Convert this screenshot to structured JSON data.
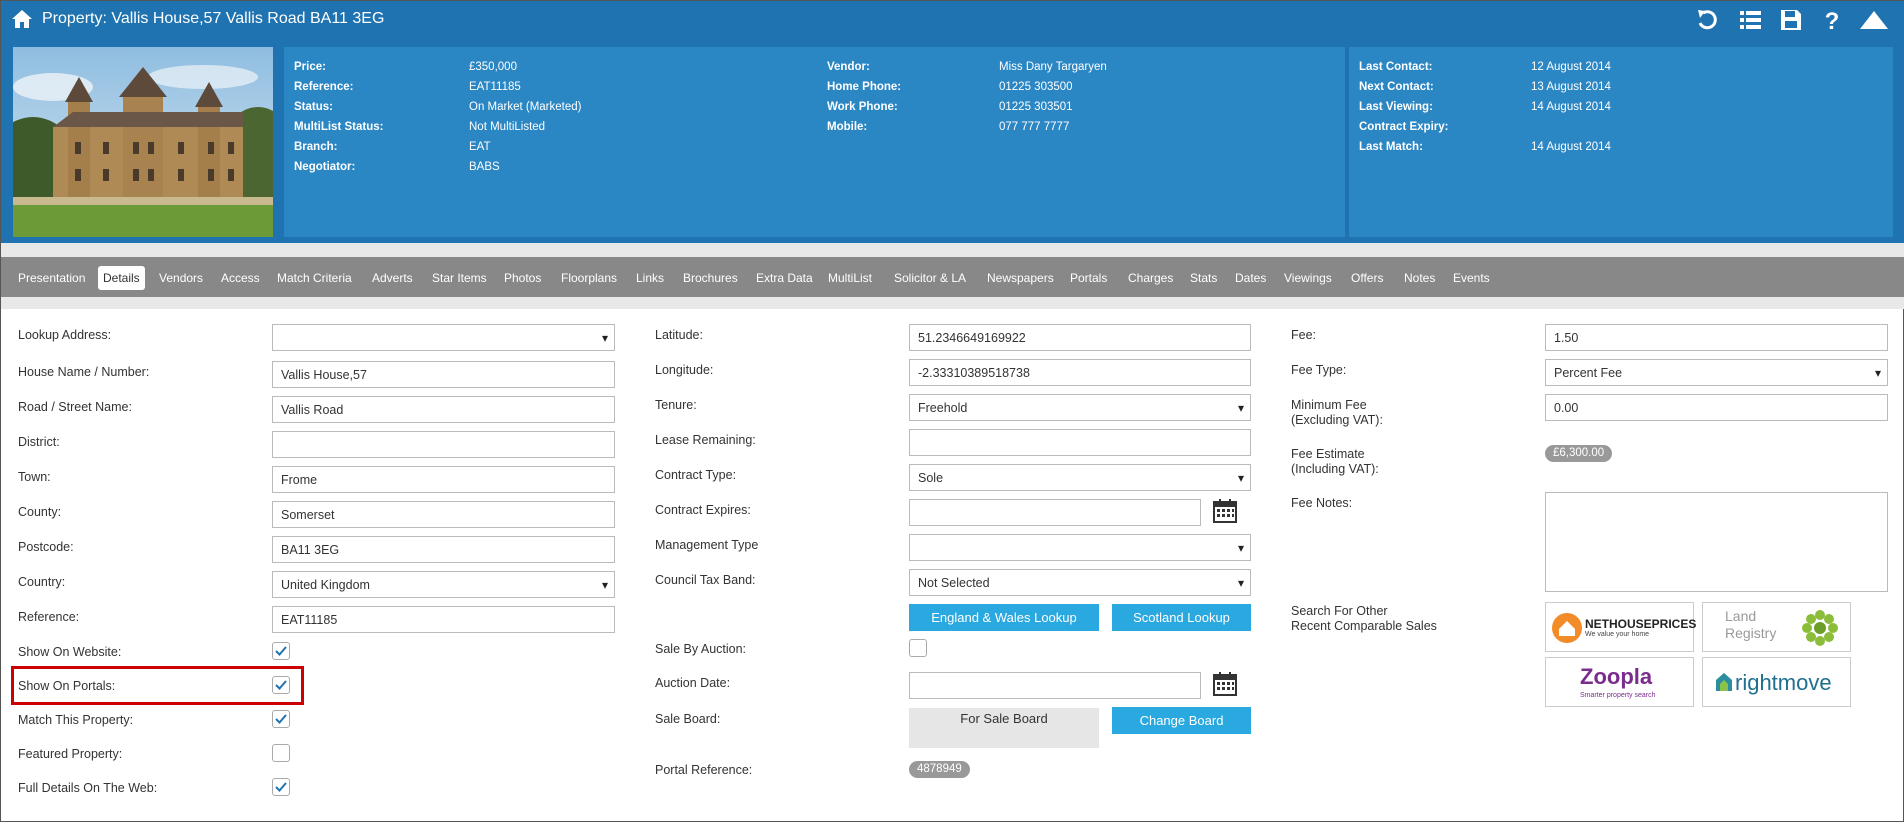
{
  "header": {
    "title": "Property: Vallis House,57 Vallis Road BA11 3EG",
    "icons": [
      "home-icon",
      "undo-icon",
      "list-icon",
      "save-icon",
      "help-icon",
      "collapse-icon"
    ]
  },
  "summary": {
    "col1": [
      {
        "k": "Price:",
        "v": "£350,000"
      },
      {
        "k": "Reference:",
        "v": "EAT11185"
      },
      {
        "k": "Status:",
        "v": "On Market (Marketed)"
      },
      {
        "k": "MultiList Status:",
        "v": "Not MultiListed"
      },
      {
        "k": "Branch:",
        "v": "EAT"
      },
      {
        "k": "Negotiator:",
        "v": "BABS"
      }
    ],
    "col2": [
      {
        "k": "Vendor:",
        "v": "Miss Dany Targaryen"
      },
      {
        "k": "Home Phone:",
        "v": "01225 303500"
      },
      {
        "k": "Work Phone:",
        "v": "01225 303501"
      },
      {
        "k": "Mobile:",
        "v": "077 777 7777"
      }
    ],
    "col3": [
      {
        "k": "Last Contact:",
        "v": "12 August 2014"
      },
      {
        "k": "Next Contact:",
        "v": "13 August 2014"
      },
      {
        "k": "Last Viewing:",
        "v": "14 August 2014"
      },
      {
        "k": "Contract Expiry:",
        "v": ""
      },
      {
        "k": "Last Match:",
        "v": "14 August 2014"
      }
    ]
  },
  "tabs": [
    "Presentation",
    "Details",
    "Vendors",
    "Access",
    "Match Criteria",
    "Adverts",
    "Star Items",
    "Photos",
    "Floorplans",
    "Links",
    "Brochures",
    "Extra Data",
    "MultiList",
    "Solicitor & LA",
    "Newspapers",
    "Portals",
    "Charges",
    "Stats",
    "Dates",
    "Viewings",
    "Offers",
    "Notes",
    "Events"
  ],
  "active_tab": "Details",
  "left": {
    "lookup_address": {
      "label": "Lookup Address:",
      "value": ""
    },
    "house_name": {
      "label": "House Name / Number:",
      "value": "Vallis House,57"
    },
    "road": {
      "label": "Road / Street Name:",
      "value": "Vallis Road"
    },
    "district": {
      "label": "District:",
      "value": ""
    },
    "town": {
      "label": "Town:",
      "value": "Frome"
    },
    "county": {
      "label": "County:",
      "value": "Somerset"
    },
    "postcode": {
      "label": "Postcode:",
      "value": "BA11 3EG"
    },
    "country": {
      "label": "Country:",
      "value": "United Kingdom"
    },
    "reference": {
      "label": "Reference:",
      "value": "EAT11185"
    },
    "show_on_website": {
      "label": "Show On Website:",
      "checked": true
    },
    "show_on_portals": {
      "label": "Show On Portals:",
      "checked": true
    },
    "match_this_property": {
      "label": "Match This Property:",
      "checked": true
    },
    "featured_property": {
      "label": "Featured Property:",
      "checked": false
    },
    "full_details_web": {
      "label": "Full Details On The Web:",
      "checked": true
    }
  },
  "middle": {
    "latitude": {
      "label": "Latitude:",
      "value": "51.2346649169922"
    },
    "longitude": {
      "label": "Longitude:",
      "value": "-2.33310389518738"
    },
    "tenure": {
      "label": "Tenure:",
      "value": "Freehold"
    },
    "lease_remaining": {
      "label": "Lease Remaining:",
      "value": ""
    },
    "contract_type": {
      "label": "Contract Type:",
      "value": "Sole"
    },
    "contract_expires": {
      "label": "Contract Expires:",
      "value": ""
    },
    "management_type": {
      "label": "Management Type",
      "value": ""
    },
    "council_tax_band": {
      "label": "Council Tax Band:",
      "value": "Not Selected"
    },
    "england_wales_lookup": "England & Wales Lookup",
    "scotland_lookup": "Scotland Lookup",
    "sale_by_auction": {
      "label": "Sale By Auction:",
      "checked": false
    },
    "auction_date": {
      "label": "Auction Date:",
      "value": ""
    },
    "sale_board": {
      "label": "Sale Board:",
      "value": "For Sale Board"
    },
    "change_board": "Change Board",
    "portal_reference": {
      "label": "Portal Reference:",
      "value": "4878949"
    }
  },
  "right": {
    "fee": {
      "label": "Fee:",
      "value": "1.50"
    },
    "fee_type": {
      "label": "Fee Type:",
      "value": "Percent Fee"
    },
    "minimum_fee": {
      "label1": "Minimum Fee",
      "label2": "(Excluding VAT):",
      "value": "0.00"
    },
    "fee_estimate": {
      "label1": "Fee Estimate",
      "label2": "(Including VAT):",
      "value": "£6,300.00"
    },
    "fee_notes": {
      "label": "Fee Notes:",
      "value": ""
    },
    "comparable": {
      "label1": "Search For Other",
      "label2": "Recent Comparable Sales"
    },
    "logos": {
      "nethouseprices": {
        "name": "NETHOUSEPRICES",
        "tagline": "We value your home"
      },
      "land_registry": {
        "line1": "Land",
        "line2": "Registry"
      },
      "zoopla": {
        "name": "Zoopla",
        "tagline": "Smarter property search"
      },
      "rightmove": {
        "name": "rightmove"
      }
    }
  },
  "colors": {
    "header": "#1f73b0",
    "panel": "#2b86c4",
    "tabbar": "#888888",
    "button": "#2aa8e0",
    "highlight": "#cc0000"
  }
}
